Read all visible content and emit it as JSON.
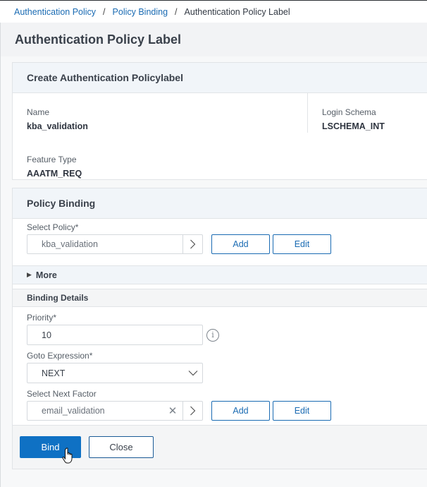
{
  "breadcrumb": {
    "items": [
      "Authentication Policy",
      "Policy Binding"
    ],
    "separator": "/",
    "current": "Authentication Policy Label"
  },
  "page": {
    "title": "Authentication Policy Label"
  },
  "create_panel": {
    "title": "Create Authentication Policylabel",
    "fields": {
      "name": {
        "label": "Name",
        "value": "kba_validation"
      },
      "login_schema": {
        "label": "Login Schema",
        "value": "LSCHEMA_INT"
      },
      "feature_type": {
        "label": "Feature Type",
        "value": "AAATM_REQ"
      }
    }
  },
  "policy_binding": {
    "title": "Policy Binding",
    "select_policy": {
      "label": "Select Policy*",
      "value": "kba_validation"
    },
    "add_label": "Add",
    "edit_label": "Edit",
    "more_label": "More",
    "binding_details": {
      "title": "Binding Details",
      "priority": {
        "label": "Priority*",
        "value": "10"
      },
      "goto_expression": {
        "label": "Goto Expression*",
        "value": "NEXT"
      },
      "next_factor": {
        "label": "Select Next Factor",
        "value": "email_validation"
      },
      "add_label": "Add",
      "edit_label": "Edit"
    }
  },
  "footer": {
    "bind_label": "Bind",
    "close_label": "Close"
  },
  "colors": {
    "accent": "#0f71c4",
    "link": "#1a6bb3"
  }
}
